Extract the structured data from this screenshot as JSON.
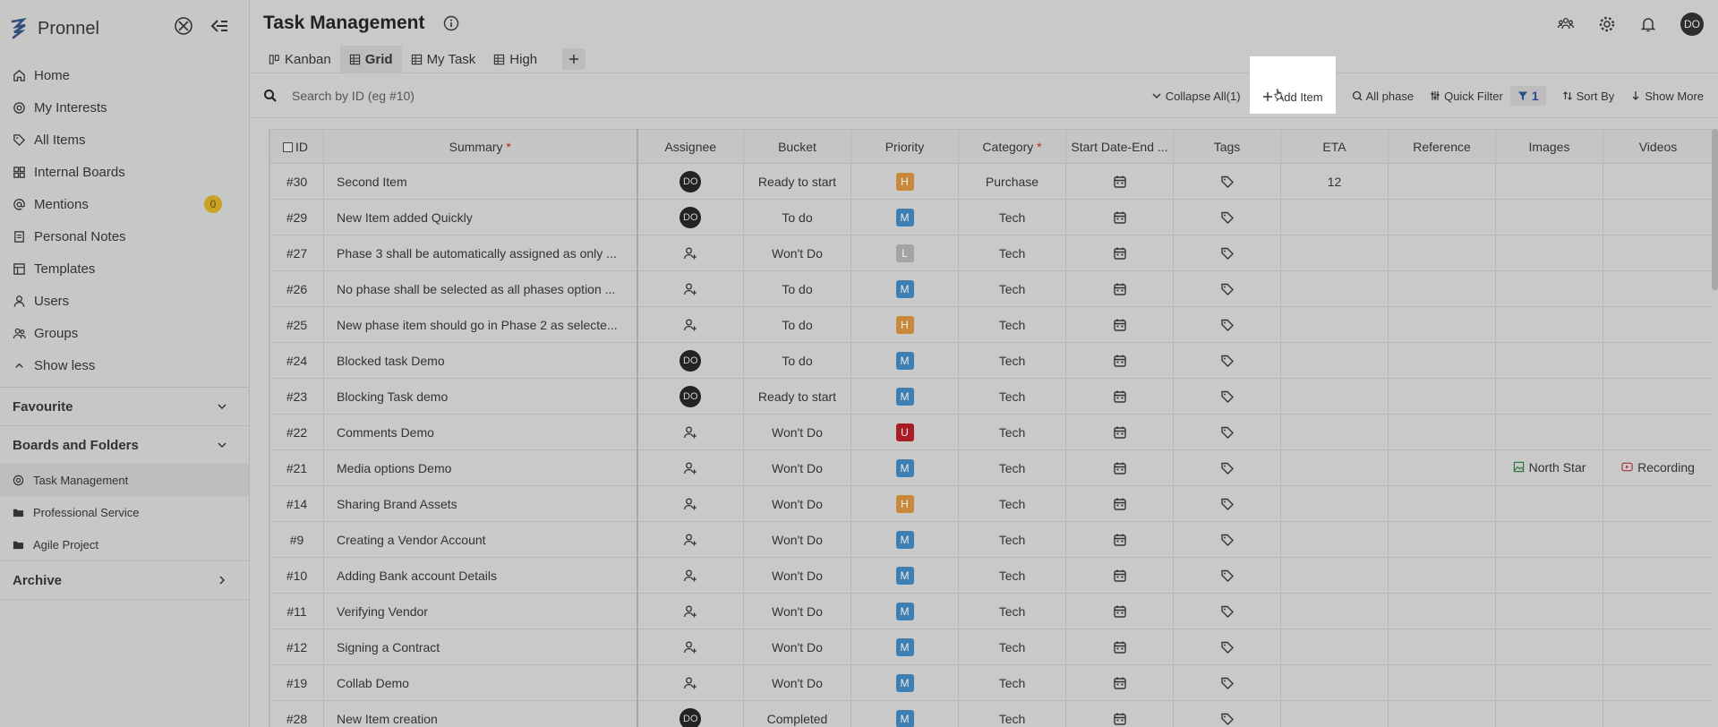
{
  "app": {
    "name": "Pronnel"
  },
  "sidebar": {
    "items": [
      {
        "label": "Home",
        "icon": "home-icon"
      },
      {
        "label": "My Interests",
        "icon": "target-icon"
      },
      {
        "label": "All Items",
        "icon": "tag-icon"
      },
      {
        "label": "Internal Boards",
        "icon": "board-icon"
      },
      {
        "label": "Mentions",
        "icon": "at-icon",
        "badge": "0"
      },
      {
        "label": "Personal Notes",
        "icon": "note-icon"
      },
      {
        "label": "Templates",
        "icon": "template-icon"
      },
      {
        "label": "Users",
        "icon": "user-icon"
      },
      {
        "label": "Groups",
        "icon": "group-icon"
      }
    ],
    "show_less": "Show less",
    "favourite": "Favourite",
    "boards_and_folders": "Boards and Folders",
    "boards": [
      {
        "label": "Task Management",
        "icon": "target-icon",
        "active": true
      },
      {
        "label": "Professional Service",
        "icon": "folder-icon"
      },
      {
        "label": "Agile Project",
        "icon": "folder-icon"
      }
    ],
    "archive": "Archive"
  },
  "header": {
    "title": "Task Management",
    "avatar": "DO"
  },
  "tabs": [
    {
      "label": "Kanban",
      "active": false
    },
    {
      "label": "Grid",
      "active": true
    },
    {
      "label": "My Task",
      "active": false
    },
    {
      "label": "High",
      "active": false
    }
  ],
  "toolbar": {
    "search_placeholder": "Search by ID (eg #10)",
    "collapse_all": "Collapse All(1)",
    "add_item": "Add Item",
    "all_phase": "All phase",
    "quick_filter": "Quick Filter",
    "filter_count": "1",
    "sort_by": "Sort By",
    "show_more": "Show More"
  },
  "grid": {
    "columns": {
      "id": "ID",
      "summary": "Summary",
      "assignee": "Assignee",
      "bucket": "Bucket",
      "priority": "Priority",
      "category": "Category",
      "dates": "Start Date-End ...",
      "tags": "Tags",
      "eta": "ETA",
      "reference": "Reference",
      "images": "Images",
      "videos": "Videos"
    },
    "required_mark": "*",
    "colors": {
      "H": "#c88a3a",
      "M": "#3d7fb3",
      "L": "#a4a4a4",
      "U": "#a81d24"
    },
    "rows": [
      {
        "id": "#30",
        "summary": "Second Item",
        "assignee": "DO",
        "bucket": "Ready to start",
        "priority": "H",
        "category": "Purchase",
        "eta": "12",
        "image": "",
        "video": ""
      },
      {
        "id": "#29",
        "summary": "New Item added Quickly",
        "assignee": "DO",
        "bucket": "To do",
        "priority": "M",
        "category": "Tech",
        "eta": "",
        "image": "",
        "video": ""
      },
      {
        "id": "#27",
        "summary": "Phase 3 shall be automatically assigned as only ...",
        "assignee": "",
        "bucket": "Won't Do",
        "priority": "L",
        "category": "Tech",
        "eta": "",
        "image": "",
        "video": ""
      },
      {
        "id": "#26",
        "summary": "No phase shall be selected as all phases option ...",
        "assignee": "",
        "bucket": "To do",
        "priority": "M",
        "category": "Tech",
        "eta": "",
        "image": "",
        "video": ""
      },
      {
        "id": "#25",
        "summary": "New phase item should go in Phase 2 as selecte...",
        "assignee": "",
        "bucket": "To do",
        "priority": "H",
        "category": "Tech",
        "eta": "",
        "image": "",
        "video": ""
      },
      {
        "id": "#24",
        "summary": "Blocked task Demo",
        "assignee": "DO",
        "bucket": "To do",
        "priority": "M",
        "category": "Tech",
        "eta": "",
        "image": "",
        "video": ""
      },
      {
        "id": "#23",
        "summary": "Blocking Task demo",
        "assignee": "DO",
        "bucket": "Ready to start",
        "priority": "M",
        "category": "Tech",
        "eta": "",
        "image": "",
        "video": ""
      },
      {
        "id": "#22",
        "summary": "Comments Demo",
        "assignee": "",
        "bucket": "Won't Do",
        "priority": "U",
        "category": "Tech",
        "eta": "",
        "image": "",
        "video": ""
      },
      {
        "id": "#21",
        "summary": "Media options Demo",
        "assignee": "",
        "bucket": "Won't Do",
        "priority": "M",
        "category": "Tech",
        "eta": "",
        "image": "North Star",
        "video": "Recording"
      },
      {
        "id": "#14",
        "summary": "Sharing Brand Assets",
        "assignee": "",
        "bucket": "Won't Do",
        "priority": "H",
        "category": "Tech",
        "eta": "",
        "image": "",
        "video": ""
      },
      {
        "id": "#9",
        "summary": "Creating a Vendor Account",
        "assignee": "",
        "bucket": "Won't Do",
        "priority": "M",
        "category": "Tech",
        "eta": "",
        "image": "",
        "video": ""
      },
      {
        "id": "#10",
        "summary": "Adding Bank account Details",
        "assignee": "",
        "bucket": "Won't Do",
        "priority": "M",
        "category": "Tech",
        "eta": "",
        "image": "",
        "video": ""
      },
      {
        "id": "#11",
        "summary": "Verifying Vendor",
        "assignee": "",
        "bucket": "Won't Do",
        "priority": "M",
        "category": "Tech",
        "eta": "",
        "image": "",
        "video": ""
      },
      {
        "id": "#12",
        "summary": "Signing a Contract",
        "assignee": "",
        "bucket": "Won't Do",
        "priority": "M",
        "category": "Tech",
        "eta": "",
        "image": "",
        "video": ""
      },
      {
        "id": "#19",
        "summary": "Collab Demo",
        "assignee": "",
        "bucket": "Won't Do",
        "priority": "M",
        "category": "Tech",
        "eta": "",
        "image": "",
        "video": ""
      },
      {
        "id": "#28",
        "summary": "New Item creation",
        "assignee": "DO",
        "bucket": "Completed",
        "priority": "M",
        "category": "Tech",
        "eta": "",
        "image": "",
        "video": ""
      }
    ]
  }
}
